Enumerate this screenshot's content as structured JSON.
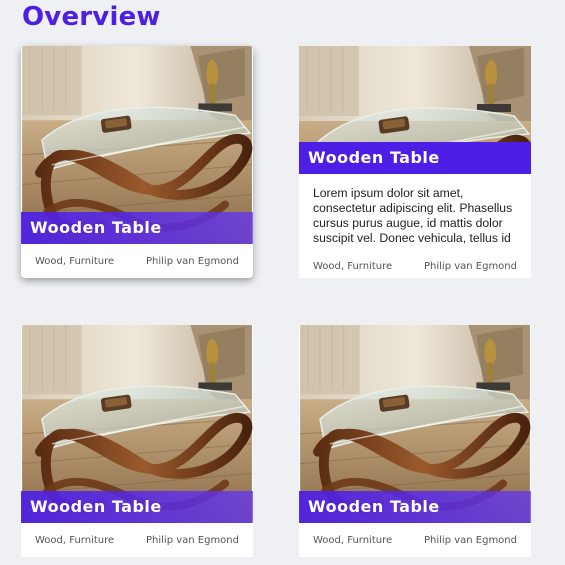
{
  "header": {
    "title": "Overview"
  },
  "colors": {
    "accent": "#4c1ee6",
    "background": "#eef0f3",
    "card": "#ffffff"
  },
  "cards": [
    {
      "title": "Wooden Table",
      "category": "Wood, Furniture",
      "author": "Philip van Egmond",
      "state": "hovered"
    },
    {
      "title": "Wooden Table",
      "description": "Lorem ipsum dolor sit amet, consectetur adipiscing elit. Phasellus cursus purus augue, id mattis dolor suscipit vel. Donec vehicula, tellus id",
      "category": "Wood, Furniture",
      "author": "Philip van Egmond",
      "state": "expanded"
    },
    {
      "title": "Wooden Table",
      "category": "Wood, Furniture",
      "author": "Philip van Egmond",
      "state": "default"
    },
    {
      "title": "Wooden Table",
      "category": "Wood, Furniture",
      "author": "Philip van Egmond",
      "state": "default"
    }
  ],
  "image": {
    "subject": "glass-top wooden table photo"
  }
}
